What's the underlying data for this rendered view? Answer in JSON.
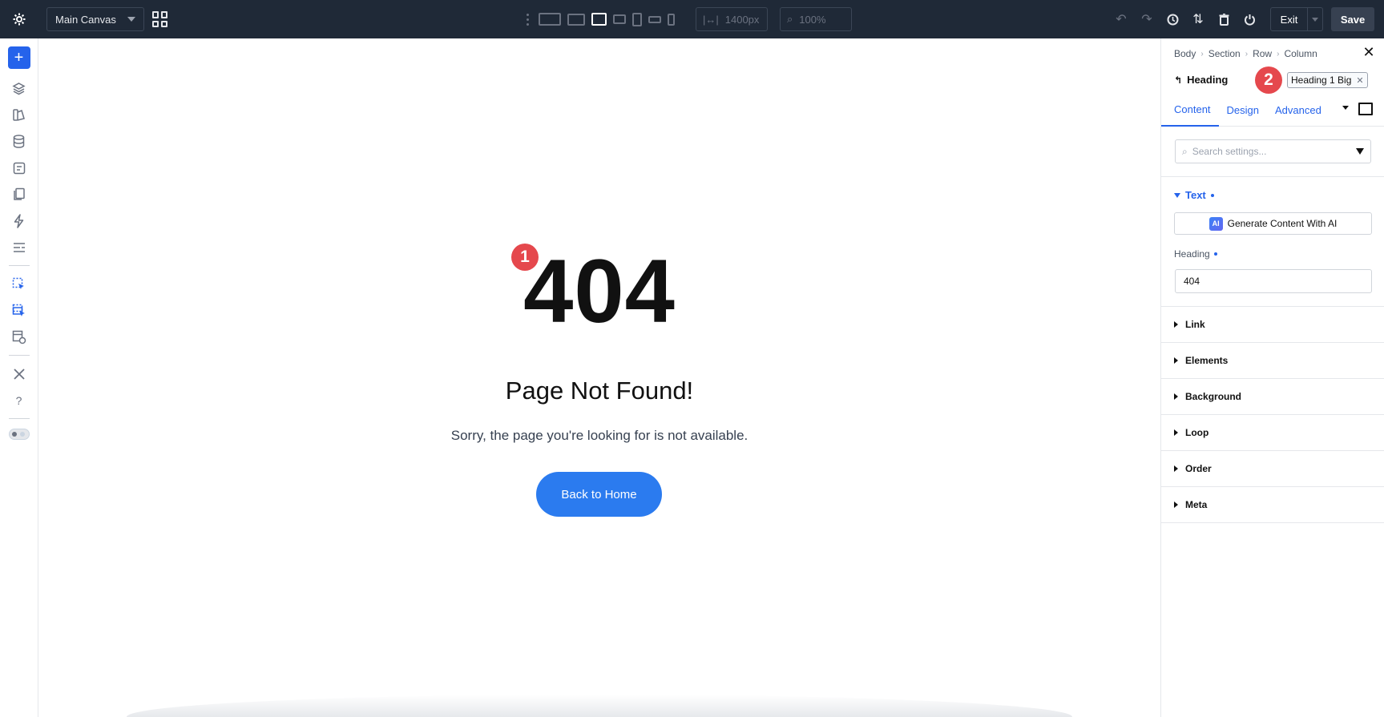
{
  "topbar": {
    "canvas_select": "Main Canvas",
    "width_value": "1400px",
    "zoom_value": "100%",
    "exit_label": "Exit",
    "save_label": "Save"
  },
  "canvas": {
    "heading": "404",
    "badge_1": "1",
    "subheading": "Page Not Found!",
    "message": "Sorry, the page you're looking for is not available.",
    "button_label": "Back to Home",
    "button_color": "#2b7bef"
  },
  "panel": {
    "breadcrumb": [
      "Body",
      "Section",
      "Row",
      "Column"
    ],
    "module_title": "Heading",
    "badge_2": "2",
    "preset_tag": "Heading 1 Big",
    "tabs": [
      "Content",
      "Design",
      "Advanced"
    ],
    "search_placeholder": "Search settings...",
    "text_group_label": "Text",
    "ai_chip": "AI",
    "ai_button_label": "Generate Content With AI",
    "heading_field_label": "Heading",
    "heading_field_value": "404",
    "accordions": [
      "Link",
      "Elements",
      "Background",
      "Loop",
      "Order",
      "Meta"
    ]
  },
  "colors": {
    "topbar_bg": "#1f2937",
    "accent": "#2563eb",
    "badge": "#e5484d"
  }
}
